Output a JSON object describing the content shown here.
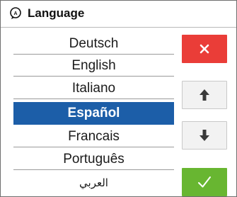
{
  "header": {
    "title": "Language",
    "icon": "language-icon"
  },
  "languages": [
    {
      "label": "Deutsch",
      "selected": false
    },
    {
      "label": "English",
      "selected": false
    },
    {
      "label": "Italiano",
      "selected": false
    },
    {
      "label": "Español",
      "selected": true
    },
    {
      "label": "Francais",
      "selected": false
    },
    {
      "label": "Português",
      "selected": false
    },
    {
      "label": "العربي",
      "selected": false
    }
  ],
  "buttons": {
    "close": {
      "icon": "close-icon",
      "color": "#ea3d38"
    },
    "up": {
      "icon": "arrow-up-icon",
      "color": "#f2f2f2"
    },
    "down": {
      "icon": "arrow-down-icon",
      "color": "#f2f2f2"
    },
    "confirm": {
      "icon": "checkmark-icon",
      "color": "#68b631"
    }
  },
  "colors": {
    "selection": "#1c5ea8"
  }
}
